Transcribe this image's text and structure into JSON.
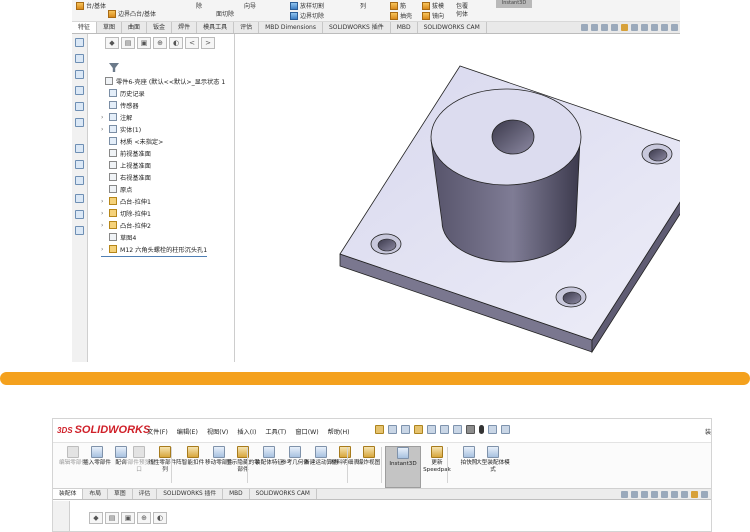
{
  "top": {
    "ribbon_items": [
      "台/基体",
      "边界凸台/基体",
      "除",
      "面切除",
      "向导",
      "放样切割",
      "边界切除",
      "列",
      "筋",
      "抽壳",
      "拔模",
      "镜向",
      "包覆",
      "何体",
      "Instant3D"
    ],
    "tabs": [
      "特征",
      "草图",
      "曲面",
      "钣金",
      "焊件",
      "模具工具",
      "评估",
      "MBD Dimensions",
      "SOLIDWORKS 插件",
      "MBD",
      "SOLIDWORKS CAM"
    ],
    "active_tab": 0,
    "tree_toolbar": [
      "◆",
      "▤",
      "▣",
      "⊕",
      "◐",
      "<",
      ">"
    ],
    "tree": [
      {
        "label": "零件6-壳座  (默认<<默认>_显示状态 1",
        "icon": "p",
        "exp": ""
      },
      {
        "label": "历史记录",
        "icon": "b",
        "exp": ""
      },
      {
        "label": "传感器",
        "icon": "b",
        "exp": ""
      },
      {
        "label": "注解",
        "icon": "b",
        "exp": "›"
      },
      {
        "label": "实体(1)",
        "icon": "b",
        "exp": "›"
      },
      {
        "label": "材质 <未指定>",
        "icon": "b",
        "exp": ""
      },
      {
        "label": "前视基准面",
        "icon": "p",
        "exp": ""
      },
      {
        "label": "上视基准面",
        "icon": "p",
        "exp": ""
      },
      {
        "label": "右视基准面",
        "icon": "p",
        "exp": ""
      },
      {
        "label": "原点",
        "icon": "p",
        "exp": ""
      },
      {
        "label": "凸台-拉伸1",
        "icon": "f",
        "exp": "›"
      },
      {
        "label": "切除-拉伸1",
        "icon": "f",
        "exp": "›"
      },
      {
        "label": "凸台-拉伸2",
        "icon": "f",
        "exp": "›"
      },
      {
        "label": "草图4",
        "icon": "p",
        "exp": ""
      },
      {
        "label": "M12 六角头螺栓的柱形沉头孔1",
        "icon": "f",
        "exp": "›"
      }
    ]
  },
  "bottom": {
    "logo_prefix": "3DS",
    "logo": "SOLIDWORKS",
    "menus": [
      "文件(F)",
      "编辑(E)",
      "视图(V)",
      "插入(I)",
      "工具(T)",
      "窗口(W)",
      "帮助(H)"
    ],
    "menu_right": "装",
    "commands": [
      {
        "label": "编辑零部件",
        "state": "dis"
      },
      {
        "label": "插入零部件",
        "state": ""
      },
      {
        "label": "配合",
        "state": ""
      },
      {
        "label": "零部件预览窗口",
        "state": "dis"
      },
      {
        "label": "线性零部件阵列",
        "state": ""
      },
      {
        "label": "智能扣件",
        "state": ""
      },
      {
        "label": "移动零部件",
        "state": ""
      },
      {
        "label": "显示隐藏的零部件",
        "state": ""
      },
      {
        "label": "装配体特征",
        "state": ""
      },
      {
        "label": "参考几何体",
        "state": ""
      },
      {
        "label": "新建运动算例",
        "state": ""
      },
      {
        "label": "材料明细表",
        "state": ""
      },
      {
        "label": "爆炸视图",
        "state": ""
      },
      {
        "label": "Instant3D",
        "state": "pressed"
      },
      {
        "label": "更新Speedpak",
        "state": ""
      },
      {
        "label": "拍快照",
        "state": ""
      },
      {
        "label": "大型装配体模式",
        "state": ""
      }
    ],
    "tabs": [
      "装配体",
      "布局",
      "草图",
      "评估",
      "SOLIDWORKS 插件",
      "MBD",
      "SOLIDWORKS CAM"
    ],
    "active_tab": 0,
    "tree_toolbar": [
      "◆",
      "▤",
      "▣",
      "⊕",
      "◐"
    ]
  },
  "colors": {
    "separator": "#f4a11e",
    "model_face": "#e3e3f4",
    "model_side": "#5f5c73",
    "logo_red": "#d0212a"
  }
}
